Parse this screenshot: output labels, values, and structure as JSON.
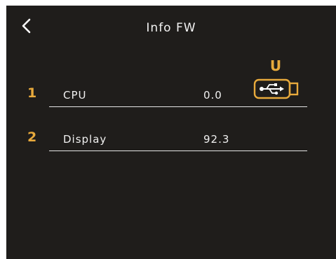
{
  "header": {
    "title": "Info FW",
    "back_icon": "chevron-left-icon"
  },
  "usb": {
    "letter": "U",
    "icon": "usb-drive-icon"
  },
  "rows": [
    {
      "number": "1",
      "label": "CPU",
      "value": "0.0"
    },
    {
      "number": "2",
      "label": "Display",
      "value": "92.3"
    }
  ],
  "colors": {
    "background": "#1f1d1b",
    "accent": "#e8aa3c",
    "text": "#f0f0f0"
  }
}
